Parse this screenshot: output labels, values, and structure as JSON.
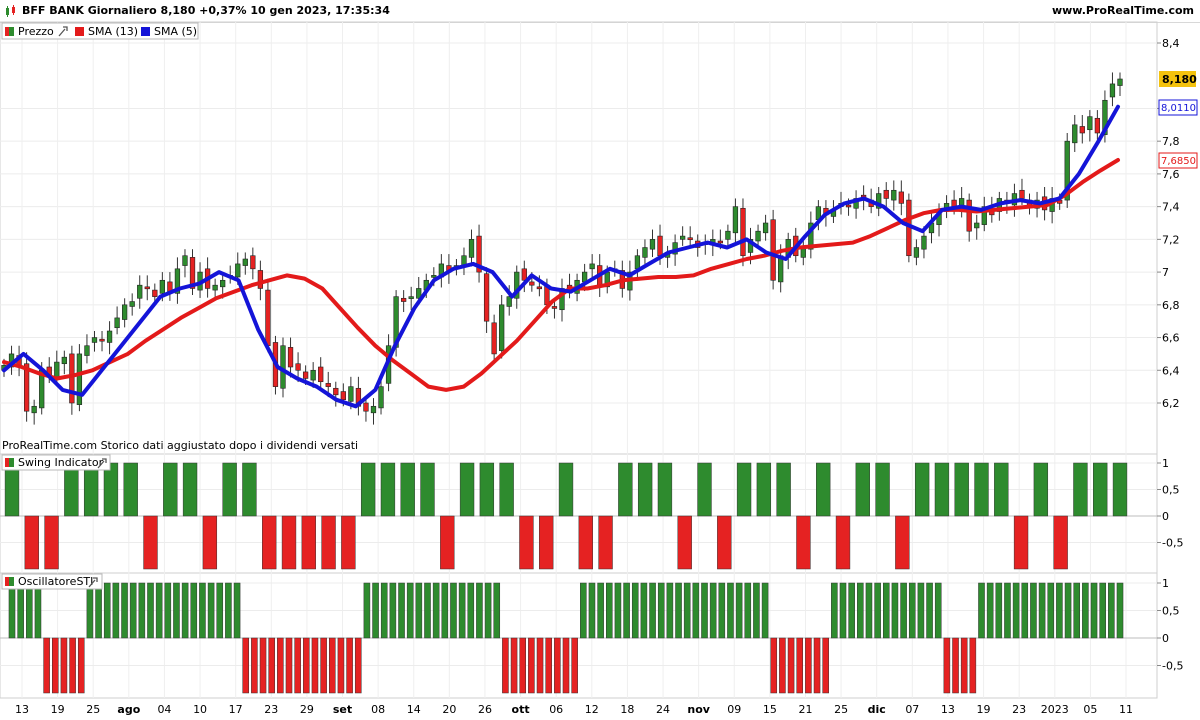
{
  "header": {
    "title": "BFF BANK Giornaliero 8,180 +0,37% 10 gen 2023, 17:35:34",
    "site": "www.ProRealTime.com"
  },
  "price_panel": {
    "legend": [
      "Prezzo",
      "SMA (13)",
      "SMA (5)"
    ],
    "note": "ProRealTime.com  Storico dati aggiustato dopo i dividendi versati",
    "yticks": [
      "8,4",
      "8",
      "7,8",
      "7,6",
      "7,4",
      "7,2",
      "7",
      "6,8",
      "6,6",
      "6,4",
      "6,2"
    ],
    "last_price": "8,180",
    "sma5_label": "8,0110",
    "sma13_label": "7,6850"
  },
  "swing_panel": {
    "legend": "Swing Indicator",
    "yticks": [
      "1",
      "0,5",
      "0",
      "-0,5"
    ]
  },
  "sti_panel": {
    "legend": "OscillatoreSTI",
    "yticks": [
      "1",
      "0,5",
      "0",
      "-0,5"
    ]
  },
  "x_axis": {
    "ticks": [
      "13",
      "19",
      "25",
      "ago",
      "04",
      "10",
      "17",
      "23",
      "29",
      "set",
      "08",
      "14",
      "20",
      "26",
      "ott",
      "06",
      "12",
      "18",
      "24",
      "nov",
      "09",
      "15",
      "21",
      "25",
      "dic",
      "07",
      "13",
      "19",
      "23",
      "2023",
      "05",
      "11"
    ]
  },
  "colors": {
    "up": "#2e8b2e",
    "down": "#e52222",
    "sma13": "#e31a1a",
    "sma5": "#1414d8",
    "last_price_bg": "#f4c20d"
  },
  "chart_data": {
    "type": "candlestick",
    "title": "BFF BANK Giornaliero",
    "approximate_closes": [
      6.43,
      6.5,
      6.42,
      6.15,
      6.18,
      6.4,
      6.37,
      6.45,
      6.48,
      6.2,
      6.5,
      6.55,
      6.6,
      6.58,
      6.64,
      6.72,
      6.8,
      6.82,
      6.92,
      6.9,
      6.85,
      6.95,
      6.88,
      7.02,
      7.1,
      6.9,
      7.0,
      6.9,
      6.92,
      6.95,
      6.98,
      7.05,
      7.08,
      7.02,
      6.9,
      6.55,
      6.3,
      6.55,
      6.42,
      6.4,
      6.35,
      6.4,
      6.33,
      6.3,
      6.25,
      6.22,
      6.3,
      6.18,
      6.15,
      6.18,
      6.3,
      6.55,
      6.85,
      6.82,
      6.85,
      6.9,
      6.95,
      6.98,
      7.05,
      7.0,
      7.04,
      7.1,
      7.2,
      7.0,
      6.7,
      6.5,
      6.8,
      6.85,
      7.0,
      6.95,
      6.92,
      6.9,
      6.8,
      6.78,
      6.9,
      6.88,
      6.95,
      7.0,
      7.05,
      6.92,
      7.0,
      7.02,
      6.9,
      7.0,
      7.1,
      7.15,
      7.2,
      7.1,
      7.12,
      7.18,
      7.22,
      7.2,
      7.15,
      7.18,
      7.2,
      7.18,
      7.25,
      7.4,
      7.1,
      7.2,
      7.25,
      7.3,
      6.95,
      7.1,
      7.2,
      7.1,
      7.15,
      7.3,
      7.4,
      7.35,
      7.38,
      7.42,
      7.4,
      7.45,
      7.45,
      7.4,
      7.48,
      7.45,
      7.5,
      7.42,
      7.1,
      7.15,
      7.22,
      7.3,
      7.38,
      7.42,
      7.4,
      7.45,
      7.25,
      7.3,
      7.4,
      7.35,
      7.45,
      7.42,
      7.48,
      7.45,
      7.4,
      7.44,
      7.38,
      7.45,
      7.42,
      7.8,
      7.9,
      7.85,
      7.95,
      7.85,
      8.05,
      8.15,
      8.18
    ],
    "sma13_approx": [
      6.45,
      6.42,
      6.38,
      6.35,
      6.37,
      6.4,
      6.45,
      6.5,
      6.58,
      6.65,
      6.72,
      6.78,
      6.84,
      6.88,
      6.92,
      6.95,
      6.98,
      6.96,
      6.9,
      6.78,
      6.66,
      6.55,
      6.46,
      6.38,
      6.3,
      6.28,
      6.3,
      6.38,
      6.48,
      6.58,
      6.7,
      6.82,
      6.9,
      6.9,
      6.92,
      6.95,
      6.96,
      6.97,
      6.97,
      6.98,
      7.02,
      7.05,
      7.08,
      7.1,
      7.13,
      7.15,
      7.16,
      7.17,
      7.18,
      7.22,
      7.27,
      7.32,
      7.36,
      7.38,
      7.38,
      7.37,
      7.38,
      7.39,
      7.4,
      7.41,
      7.47,
      7.55,
      7.62,
      7.685
    ],
    "sma5_approx": [
      6.4,
      6.5,
      6.4,
      6.28,
      6.25,
      6.4,
      6.55,
      6.7,
      6.85,
      6.9,
      6.93,
      7.0,
      6.95,
      6.65,
      6.42,
      6.35,
      6.3,
      6.22,
      6.18,
      6.28,
      6.55,
      6.78,
      6.95,
      7.02,
      7.05,
      7.0,
      6.85,
      6.98,
      6.9,
      6.88,
      6.95,
      7.02,
      6.98,
      7.05,
      7.12,
      7.15,
      7.18,
      7.15,
      7.2,
      7.12,
      7.08,
      7.22,
      7.35,
      7.42,
      7.45,
      7.4,
      7.3,
      7.25,
      7.38,
      7.4,
      7.38,
      7.42,
      7.44,
      7.42,
      7.45,
      7.6,
      7.8,
      8.011
    ],
    "swing_indicator": [
      1,
      -1,
      -1,
      1,
      1,
      1,
      1,
      -1,
      1,
      1,
      -1,
      1,
      1,
      -1,
      -1,
      -1,
      -1,
      -1,
      1,
      1,
      1,
      1,
      -1,
      1,
      1,
      1,
      -1,
      -1,
      1,
      -1,
      -1,
      1,
      1,
      1,
      -1,
      1,
      -1,
      1,
      1,
      1,
      -1,
      1,
      -1,
      1,
      1,
      -1,
      1,
      1,
      1,
      1,
      1,
      -1,
      1,
      -1,
      1,
      1,
      1
    ],
    "oscillator_sti": [
      1,
      1,
      1,
      1,
      -1,
      -1,
      -1,
      -1,
      -1,
      1,
      1,
      1,
      1,
      1,
      1,
      1,
      1,
      1,
      1,
      1,
      1,
      1,
      1,
      1,
      1,
      1,
      1,
      -1,
      -1,
      -1,
      -1,
      -1,
      -1,
      -1,
      -1,
      -1,
      -1,
      -1,
      -1,
      -1,
      -1,
      1,
      1,
      1,
      1,
      1,
      1,
      1,
      1,
      1,
      1,
      1,
      1,
      1,
      1,
      1,
      1,
      -1,
      -1,
      -1,
      -1,
      -1,
      -1,
      -1,
      -1,
      -1,
      1,
      1,
      1,
      1,
      1,
      1,
      1,
      1,
      1,
      1,
      1,
      1,
      1,
      1,
      1,
      1,
      1,
      1,
      1,
      1,
      1,
      1,
      -1,
      -1,
      -1,
      -1,
      -1,
      -1,
      -1,
      1,
      1,
      1,
      1,
      1,
      1,
      1,
      1,
      1,
      1,
      1,
      1,
      1,
      -1,
      -1,
      -1,
      -1,
      1,
      1,
      1,
      1,
      1,
      1,
      1,
      1,
      1,
      1,
      1,
      1,
      1,
      1,
      1,
      1,
      1
    ],
    "ylim_price": [
      6.0,
      8.5
    ],
    "ylim_indicators": [
      -1,
      1
    ]
  }
}
